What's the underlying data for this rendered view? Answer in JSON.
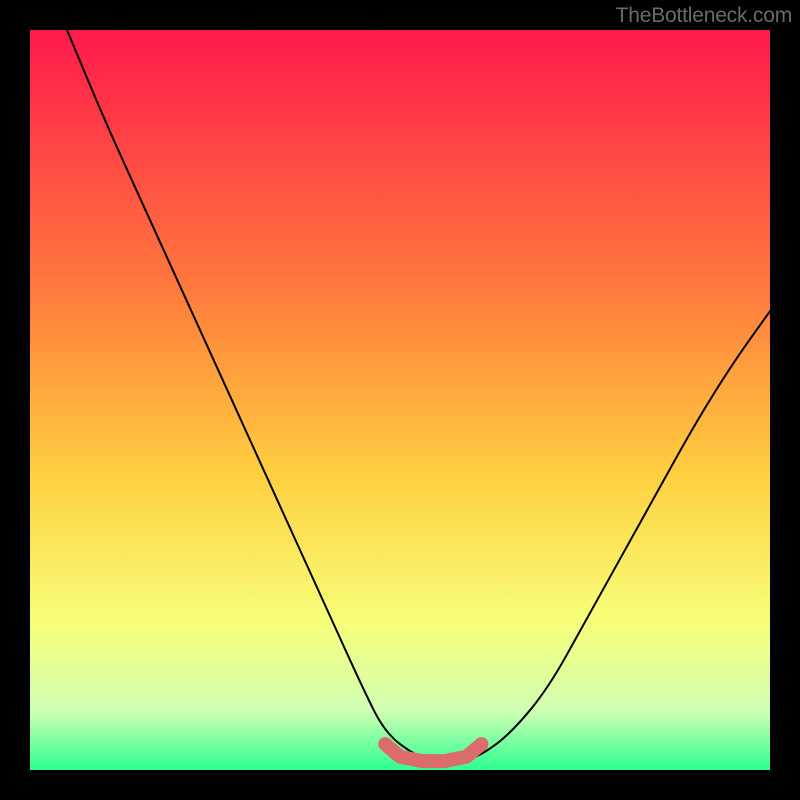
{
  "watermark": "TheBottleneck.com",
  "chart_data": {
    "type": "line",
    "title": "",
    "xlabel": "",
    "ylabel": "",
    "xlim": [
      0,
      100
    ],
    "ylim": [
      0,
      100
    ],
    "background_gradient_stops": [
      {
        "offset": 0,
        "color": "#ff1a4b"
      },
      {
        "offset": 35,
        "color": "#ff7a3d"
      },
      {
        "offset": 60,
        "color": "#ffcf3f"
      },
      {
        "offset": 80,
        "color": "#f7ff7a"
      },
      {
        "offset": 92,
        "color": "#d0ffb4"
      },
      {
        "offset": 100,
        "color": "#2cff8f"
      }
    ],
    "series": [
      {
        "name": "bottleneck-curve",
        "color": "#000000",
        "x": [
          5,
          10,
          15,
          20,
          25,
          30,
          35,
          40,
          45,
          48,
          52,
          55,
          58,
          61,
          65,
          70,
          75,
          80,
          85,
          90,
          95,
          100
        ],
        "y": [
          100,
          88,
          77,
          66,
          55,
          44,
          33,
          22,
          11,
          5,
          2,
          1,
          1,
          2,
          5,
          11,
          20,
          29,
          38,
          47,
          55,
          62
        ]
      },
      {
        "name": "optimal-zone-highlight",
        "color": "#dc6b6b",
        "x": [
          48,
          50,
          53,
          56,
          59,
          61
        ],
        "y": [
          3.5,
          1.8,
          1.2,
          1.2,
          1.8,
          3.5
        ]
      }
    ]
  }
}
